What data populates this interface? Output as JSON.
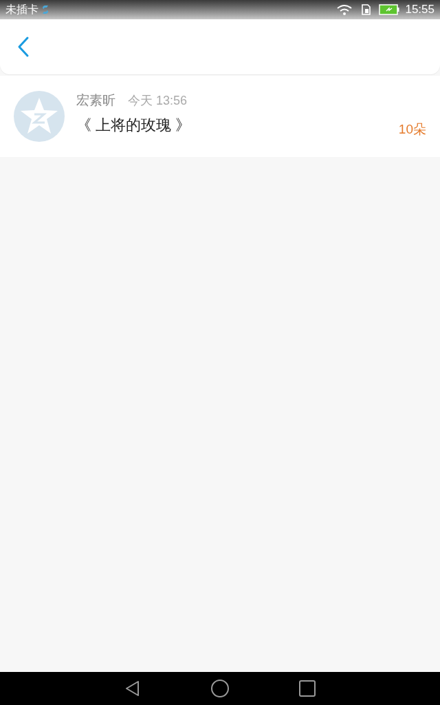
{
  "status_bar": {
    "carrier": "未插卡",
    "time": "15:55"
  },
  "gifts": [
    {
      "sender": "宏素昕",
      "time": "今天 13:56",
      "title": "《 上将的玫瑰 》",
      "count": "10朵"
    }
  ]
}
